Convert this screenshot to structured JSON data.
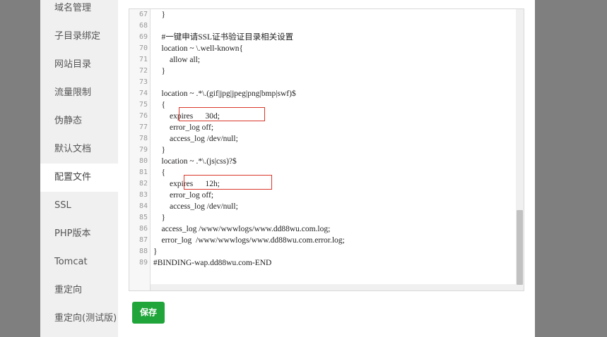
{
  "sidebar": {
    "items": [
      {
        "label": "域名管理"
      },
      {
        "label": "子目录绑定"
      },
      {
        "label": "网站目录"
      },
      {
        "label": "流量限制"
      },
      {
        "label": "伪静态"
      },
      {
        "label": "默认文档"
      },
      {
        "label": "配置文件",
        "active": true
      },
      {
        "label": "SSL"
      },
      {
        "label": "PHP版本"
      },
      {
        "label": "Tomcat"
      },
      {
        "label": "重定向"
      },
      {
        "label": "重定向(测试版)"
      }
    ]
  },
  "editor": {
    "lines": [
      {
        "n": "67",
        "text": "    }"
      },
      {
        "n": "68",
        "text": ""
      },
      {
        "n": "69",
        "text": "    #一键申请SSL证书验证目录相关设置"
      },
      {
        "n": "70",
        "text": "    location ~ \\.well-known{"
      },
      {
        "n": "71",
        "text": "        allow all;"
      },
      {
        "n": "72",
        "text": "    }"
      },
      {
        "n": "73",
        "text": ""
      },
      {
        "n": "74",
        "text": "    location ~ .*\\.(gif|jpg|jpeg|png|bmp|swf)$"
      },
      {
        "n": "75",
        "text": "    {"
      },
      {
        "n": "76",
        "text": "        expires      30d;"
      },
      {
        "n": "77",
        "text": "        error_log off;"
      },
      {
        "n": "78",
        "text": "        access_log /dev/null;"
      },
      {
        "n": "79",
        "text": "    }"
      },
      {
        "n": "80",
        "text": "    location ~ .*\\.(js|css)?$"
      },
      {
        "n": "81",
        "text": "    {"
      },
      {
        "n": "82",
        "text": "        expires      12h;"
      },
      {
        "n": "83",
        "text": "        error_log off;"
      },
      {
        "n": "84",
        "text": "        access_log /dev/null;"
      },
      {
        "n": "85",
        "text": "    }"
      },
      {
        "n": "86",
        "text": "    access_log /www/wwwlogs/www.dd88wu.com.log;"
      },
      {
        "n": "87",
        "text": "    error_log  /www/wwwlogs/www.dd88wu.com.error.log;"
      },
      {
        "n": "88",
        "text": "}"
      },
      {
        "n": "89",
        "text": "#BINDING-wap.dd88wu.com-END"
      }
    ]
  },
  "actions": {
    "save_label": "保存"
  },
  "colors": {
    "accent": "#20a53a",
    "highlight_border": "#d9382c"
  }
}
